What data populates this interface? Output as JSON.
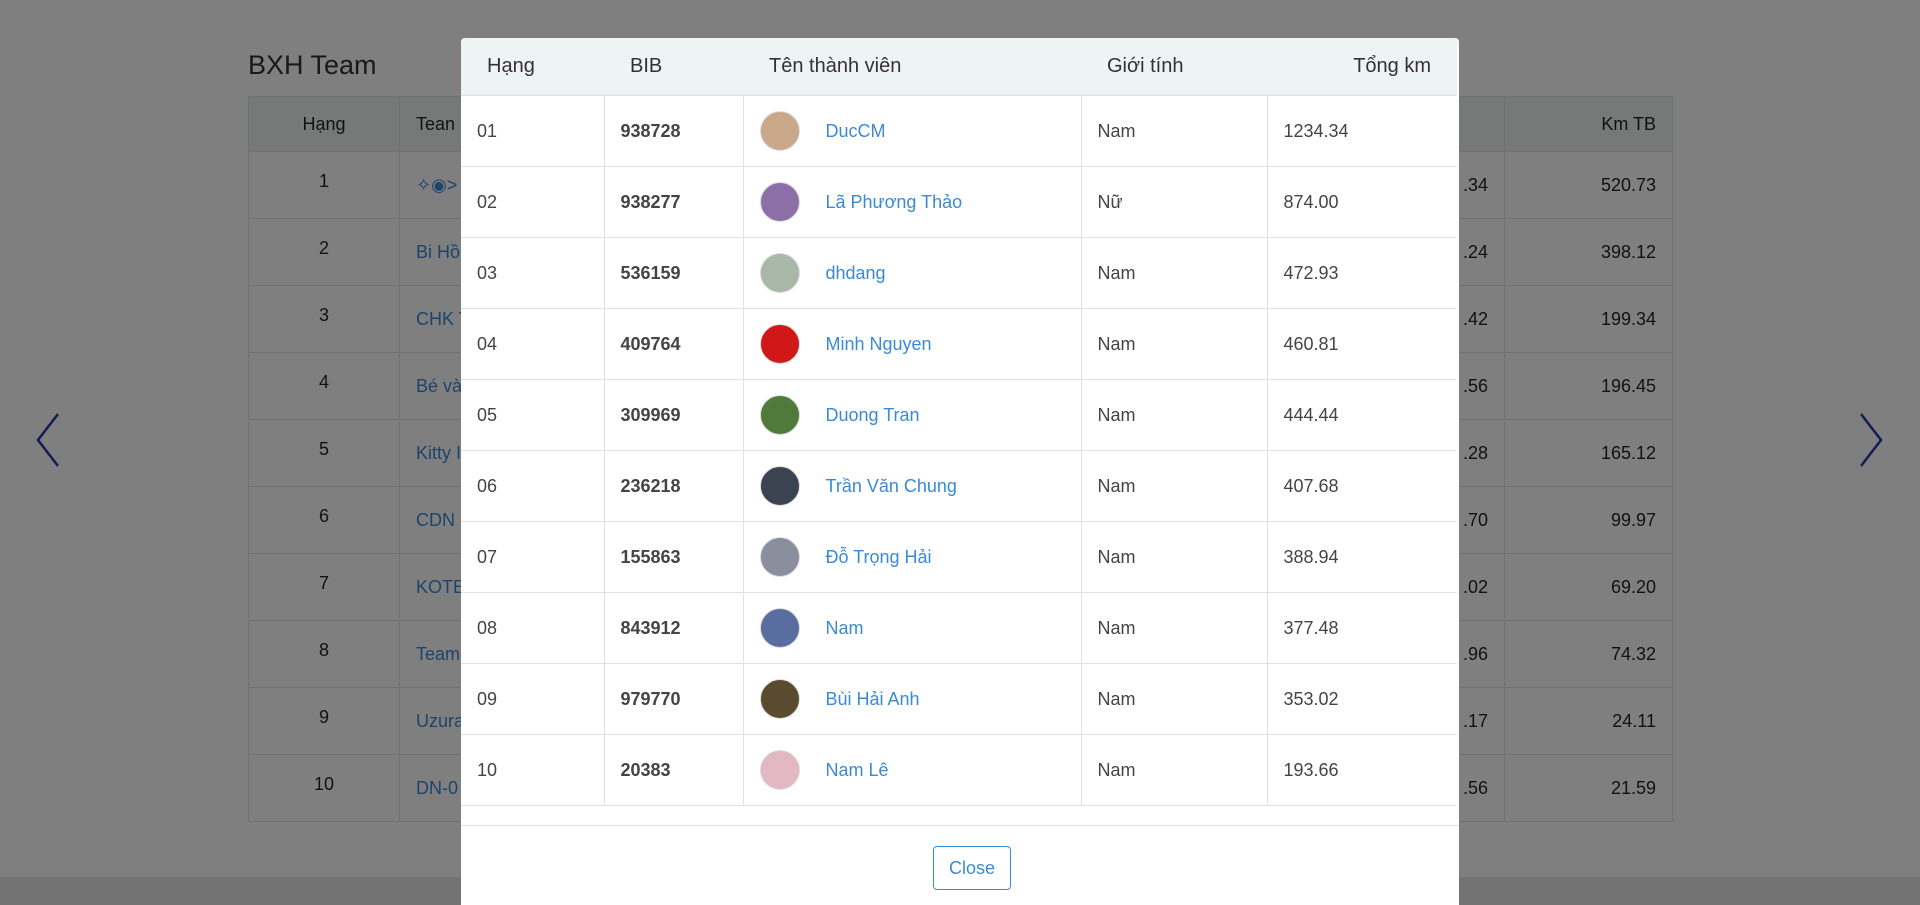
{
  "background": {
    "title": "BXH Team",
    "headers": {
      "rank": "Hạng",
      "team": "Tean",
      "avg_km": "Km TB"
    },
    "rows": [
      {
        "rank": "1",
        "team": "✧◉>",
        "km": ".34",
        "avg_km": "520.73"
      },
      {
        "rank": "2",
        "team": "Bi Hồ",
        "km": ".24",
        "avg_km": "398.12"
      },
      {
        "rank": "3",
        "team": "CHK T",
        "km": ".42",
        "avg_km": "199.34"
      },
      {
        "rank": "4",
        "team": "Bé và",
        "km": ".56",
        "avg_km": "196.45"
      },
      {
        "rank": "5",
        "team": "Kitty I",
        "km": ".28",
        "avg_km": "165.12"
      },
      {
        "rank": "6",
        "team": "CDN I",
        "km": ".70",
        "avg_km": "99.97"
      },
      {
        "rank": "7",
        "team": "KOTE",
        "km": ".02",
        "avg_km": "69.20"
      },
      {
        "rank": "8",
        "team": "Team",
        "km": ".96",
        "avg_km": "74.32"
      },
      {
        "rank": "9",
        "team": "Uzura",
        "km": ".17",
        "avg_km": "24.11"
      },
      {
        "rank": "10",
        "team": "DN-0",
        "km": ".56",
        "avg_km": "21.59"
      }
    ],
    "nav": {
      "prev_icon": "chevron-left-icon",
      "next_icon": "chevron-right-icon",
      "color": "#2d35a8"
    }
  },
  "modal": {
    "headers": {
      "rank": "Hạng",
      "bib": "BIB",
      "member": "Tên thành viên",
      "gender": "Giới tính",
      "total_km": "Tổng km"
    },
    "rows": [
      {
        "rank": "01",
        "bib": "938728",
        "name": "DucCM",
        "gender": "Nam",
        "total_km": "1234.34",
        "avatar_color": "#c9a98a"
      },
      {
        "rank": "02",
        "bib": "938277",
        "name": "Lã Phương Thảo",
        "gender": "Nữ",
        "total_km": "874.00",
        "avatar_color": "#8d6fa8"
      },
      {
        "rank": "03",
        "bib": "536159",
        "name": "dhdang",
        "gender": "Nam",
        "total_km": "472.93",
        "avatar_color": "#a9b7a8"
      },
      {
        "rank": "04",
        "bib": "409764",
        "name": "Minh Nguyen",
        "gender": "Nam",
        "total_km": "460.81",
        "avatar_color": "#d01818"
      },
      {
        "rank": "05",
        "bib": "309969",
        "name": "Duong Tran",
        "gender": "Nam",
        "total_km": "444.44",
        "avatar_color": "#4f7a3a"
      },
      {
        "rank": "06",
        "bib": "236218",
        "name": "Trần Văn Chung",
        "gender": "Nam",
        "total_km": "407.68",
        "avatar_color": "#3b4250"
      },
      {
        "rank": "07",
        "bib": "155863",
        "name": "Đỗ Trọng Hải",
        "gender": "Nam",
        "total_km": "388.94",
        "avatar_color": "#8a8f9e"
      },
      {
        "rank": "08",
        "bib": "843912",
        "name": "Nam",
        "gender": "Nam",
        "total_km": "377.48",
        "avatar_color": "#5a6da0"
      },
      {
        "rank": "09",
        "bib": "979770",
        "name": "Bùi Hải Anh",
        "gender": "Nam",
        "total_km": "353.02",
        "avatar_color": "#5a4a2e"
      },
      {
        "rank": "10",
        "bib": "20383",
        "name": "Nam Lê",
        "gender": "Nam",
        "total_km": "193.66",
        "avatar_color": "#e3b7c4"
      }
    ],
    "close_label": "Close",
    "accent_color": "#3a8ad6"
  }
}
